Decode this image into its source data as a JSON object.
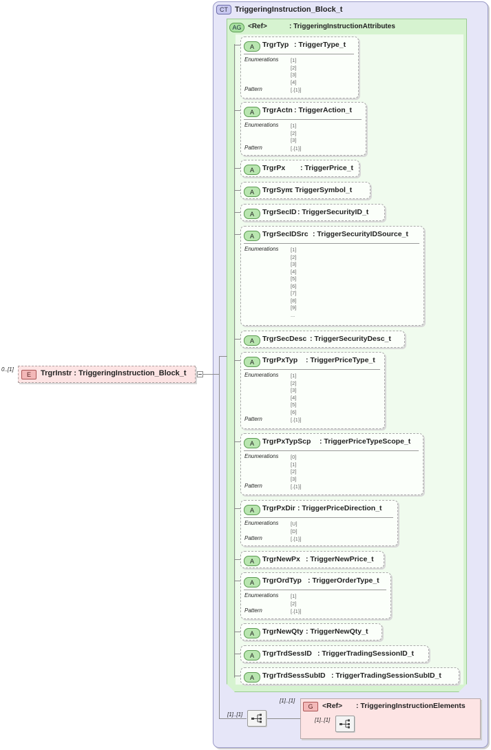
{
  "complex_type": {
    "badge": "CT",
    "title": "TriggeringInstruction_Block_t"
  },
  "attribute_group": {
    "badge": "AG",
    "ref": "<Ref>",
    "type": ": TriggeringInstructionAttributes"
  },
  "labels": {
    "enumerations": "Enumerations",
    "pattern": "Pattern"
  },
  "attributes": [
    {
      "badge": "A",
      "name": "TrgrTyp",
      "type": ": TriggerType_t",
      "enumerations": [
        "[1]",
        "[2]",
        "[3]",
        "[4]"
      ],
      "pattern": "[.{1}]"
    },
    {
      "badge": "A",
      "name": "TrgrActn",
      "type": ": TriggerAction_t",
      "enumerations": [
        "[1]",
        "[2]",
        "[3]"
      ],
      "pattern": "[.{1}]"
    },
    {
      "badge": "A",
      "name": "TrgrPx",
      "type": ": TriggerPrice_t"
    },
    {
      "badge": "A",
      "name": "TrgrSym",
      "type": ": TriggerSymbol_t"
    },
    {
      "badge": "A",
      "name": "TrgrSecID",
      "type": ": TriggerSecurityID_t"
    },
    {
      "badge": "A",
      "name": "TrgrSecIDSrc",
      "type": ": TriggerSecurityIDSource_t",
      "enumerations": [
        "[1]",
        "[2]",
        "[3]",
        "[4]",
        "[5]",
        "[6]",
        "[7]",
        "[8]",
        "[9]",
        "..."
      ]
    },
    {
      "badge": "A",
      "name": "TrgrSecDesc",
      "type": ": TriggerSecurityDesc_t"
    },
    {
      "badge": "A",
      "name": "TrgrPxTyp",
      "type": ": TriggerPriceType_t",
      "enumerations": [
        "[1]",
        "[2]",
        "[3]",
        "[4]",
        "[5]",
        "[6]"
      ],
      "pattern": "[.{1}]"
    },
    {
      "badge": "A",
      "name": "TrgrPxTypScp",
      "type": ": TriggerPriceTypeScope_t",
      "enumerations": [
        "[0]",
        "[1]",
        "[2]",
        "[3]"
      ],
      "pattern": "[.{1}]"
    },
    {
      "badge": "A",
      "name": "TrgrPxDir",
      "type": ": TriggerPriceDirection_t",
      "enumerations": [
        "[U]",
        "[D]"
      ],
      "pattern": "[.{1}]"
    },
    {
      "badge": "A",
      "name": "TrgrNewPx",
      "type": ": TriggerNewPrice_t"
    },
    {
      "badge": "A",
      "name": "TrgrOrdTyp",
      "type": ": TriggerOrderType_t",
      "enumerations": [
        "[1]",
        "[2]"
      ],
      "pattern": "[.{1}]"
    },
    {
      "badge": "A",
      "name": "TrgrNewQty",
      "type": ": TriggerNewQty_t"
    },
    {
      "badge": "A",
      "name": "TrgrTrdSessID",
      "type": ": TriggerTradingSessionID_t"
    },
    {
      "badge": "A",
      "name": "TrgrTrdSessSubID",
      "type": ": TriggerTradingSessionSubID_t"
    }
  ],
  "element": {
    "badge": "E",
    "name": "TrgrInstr",
    "type": ": TriggeringInstruction_Block_t",
    "cardinality": "0..[1]"
  },
  "sequence_cardinality": "[1]..[1]",
  "group": {
    "badge": "G",
    "ref": "<Ref>",
    "type": ": TriggeringInstructionElements",
    "cardinality": "[1]..[1]",
    "inner_cardinality": "[1]..[1]"
  }
}
